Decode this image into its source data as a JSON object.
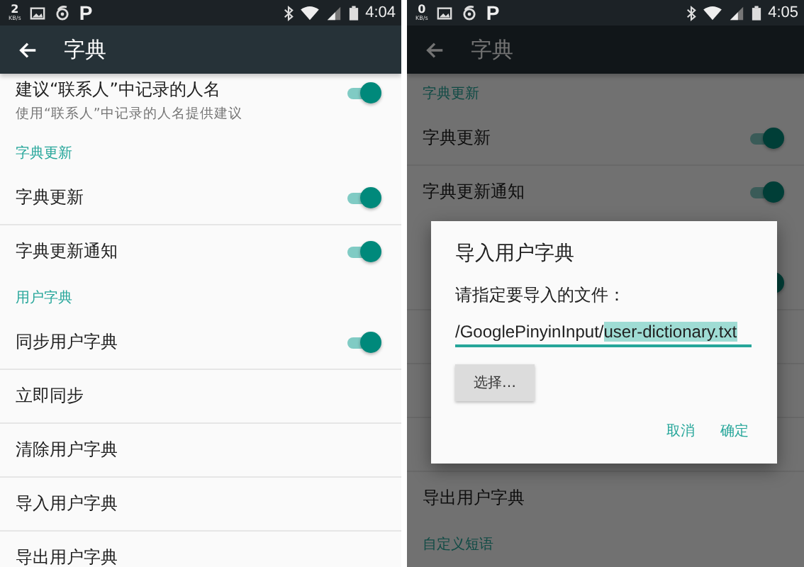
{
  "screens": [
    {
      "status_bar": {
        "net_speed": "2",
        "net_unit": "KB/s",
        "app_letter": "P",
        "time": "4:04"
      },
      "toolbar": {
        "title": "字典"
      },
      "items": [
        {
          "kind": "switch",
          "label": "建议“联系人”中记录的人名",
          "subtitle": "使用“联系人”中记录的人名提供建议",
          "on": true
        },
        {
          "kind": "section",
          "label": "字典更新"
        },
        {
          "kind": "switch",
          "label": "字典更新",
          "on": true
        },
        {
          "kind": "switch",
          "label": "字典更新通知",
          "on": true
        },
        {
          "kind": "section",
          "label": "用户字典"
        },
        {
          "kind": "switch",
          "label": "同步用户字典",
          "on": true
        },
        {
          "kind": "action",
          "label": "立即同步"
        },
        {
          "kind": "action",
          "label": "清除用户字典"
        },
        {
          "kind": "action",
          "label": "导入用户字典"
        },
        {
          "kind": "action",
          "label": "导出用户字典"
        }
      ]
    },
    {
      "status_bar": {
        "net_speed": "0",
        "net_unit": "KB/s",
        "app_letter": "P",
        "time": "4:05"
      },
      "toolbar": {
        "title": "字典"
      },
      "items": [
        {
          "kind": "section",
          "label": "字典更新"
        },
        {
          "kind": "switch",
          "label": "字典更新",
          "on": true
        },
        {
          "kind": "switch",
          "label": "字典更新通知",
          "on": true
        },
        {
          "kind": "section"
        },
        {
          "kind": "switch",
          "on": true
        },
        {
          "kind": "action"
        },
        {
          "kind": "action"
        },
        {
          "kind": "action"
        },
        {
          "kind": "action",
          "label": "导出用户字典"
        },
        {
          "kind": "section",
          "label": "自定义短语"
        }
      ],
      "dialog": {
        "title": "导入用户字典",
        "message": "请指定要导入的文件：",
        "field": {
          "value": "/GooglePinyinInput/",
          "selection": "user-dictionary.txt"
        },
        "choose_button": "选择…",
        "buttons": [
          "取消",
          "确定"
        ]
      }
    }
  ]
}
